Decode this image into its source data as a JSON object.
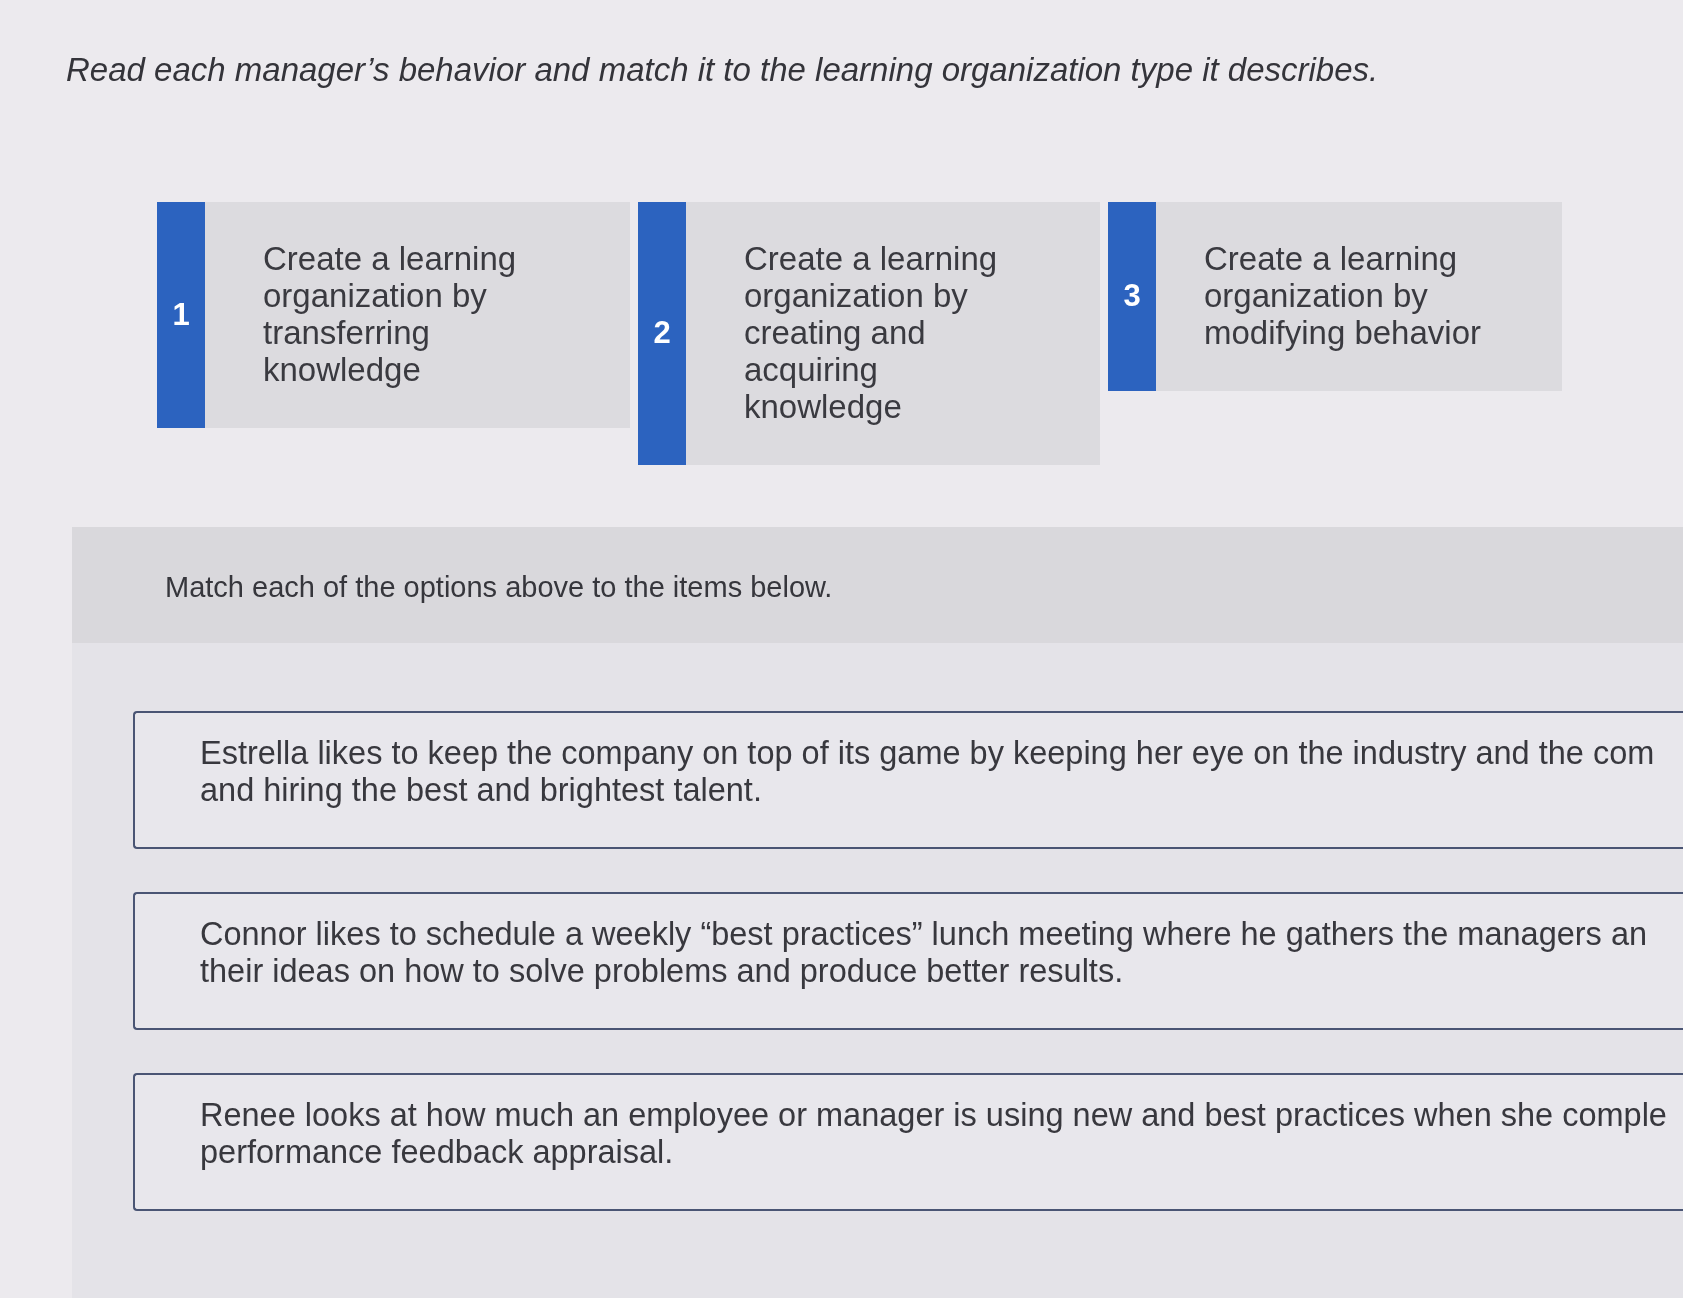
{
  "instruction": "Read each manager’s behavior and match it to the learning organization type it describes.",
  "options": [
    {
      "number": "1",
      "text": "Create a learning organization by transferring knowledge"
    },
    {
      "number": "2",
      "text": "Create a learning organization by creating and acquiring knowledge"
    },
    {
      "number": "3",
      "text": "Create a learning organization by modifying behavior"
    }
  ],
  "match_panel": {
    "prompt": "Match each of the options above to the items below."
  },
  "items": [
    {
      "lines": [
        "Estrella likes to keep the company on top of its game by keeping her eye on the industry and the com",
        "and hiring the best and brightest talent."
      ]
    },
    {
      "lines": [
        "Connor likes to schedule a weekly “best practices” lunch meeting where he gathers the managers an",
        "their ideas on how to solve problems and produce better results."
      ]
    },
    {
      "lines": [
        "Renee looks at how much an employee or manager is using new and best practices when she comple",
        "performance feedback appraisal."
      ]
    }
  ]
}
